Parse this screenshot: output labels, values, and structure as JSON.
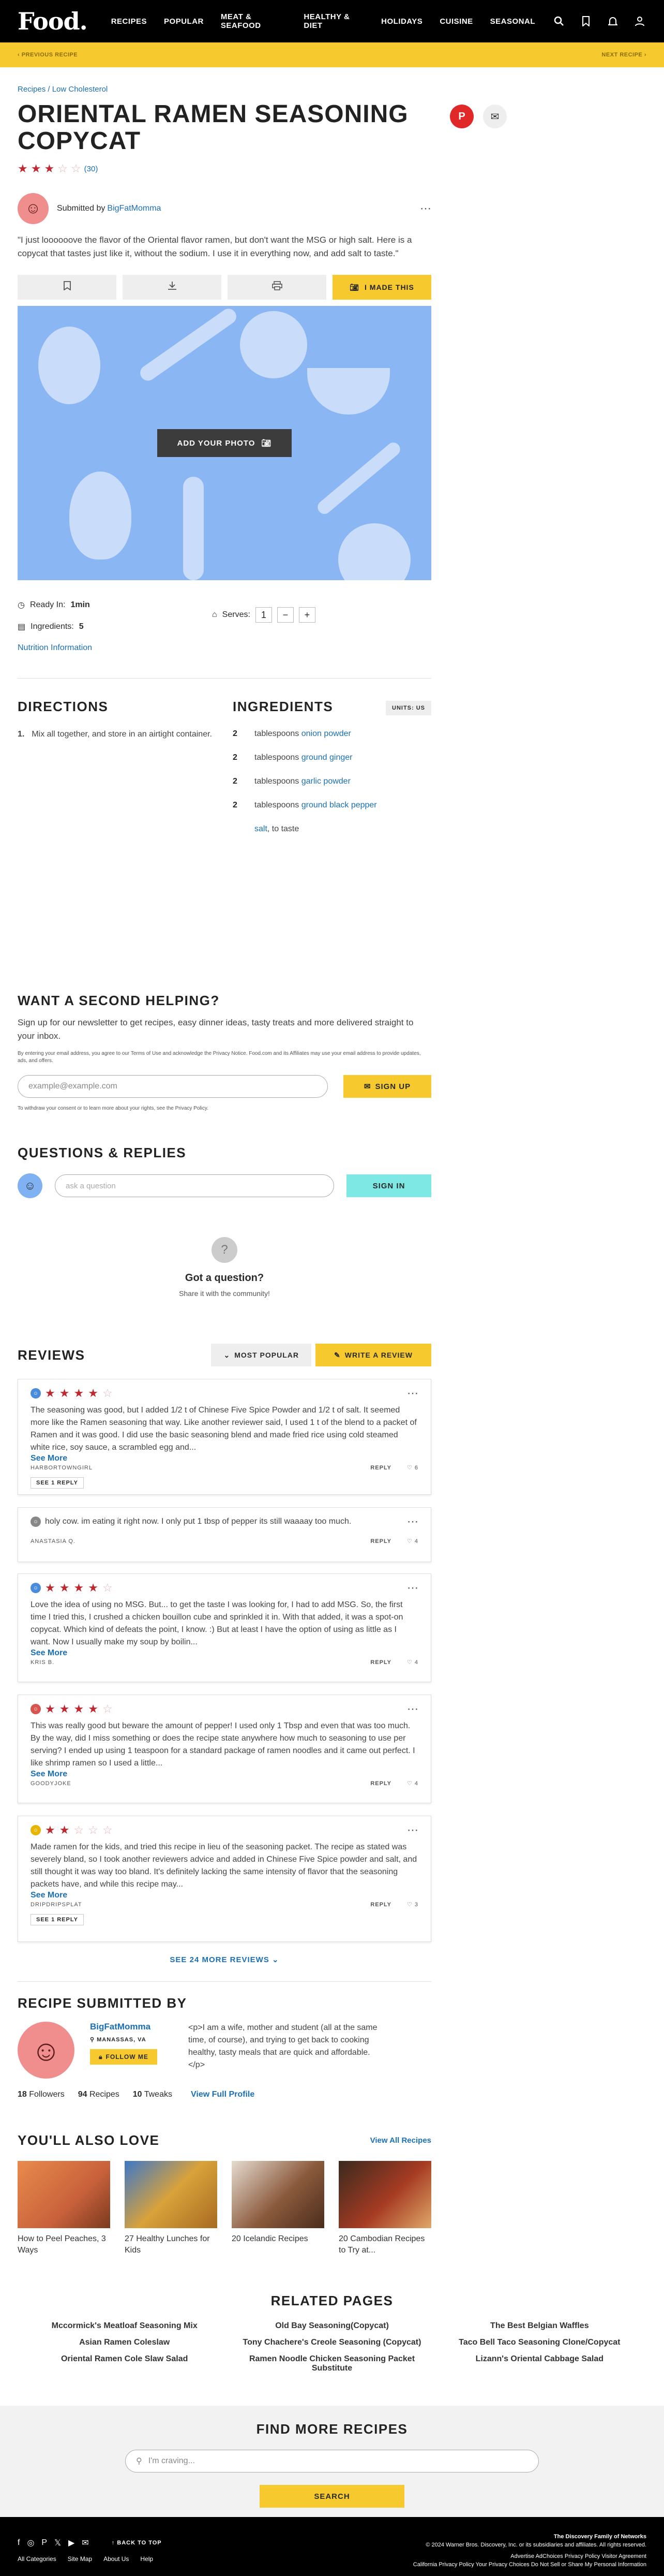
{
  "nav": {
    "logo": "Food.",
    "items": [
      "RECIPES",
      "POPULAR",
      "MEAT & SEAFOOD",
      "HEALTHY & DIET",
      "HOLIDAYS",
      "CUISINE",
      "SEASONAL"
    ],
    "icons": [
      "search-icon",
      "bookmark-icon",
      "bell-icon",
      "user-icon"
    ]
  },
  "promo": {
    "prev": "‹ PREVIOUS RECIPE",
    "next": "NEXT RECIPE ›"
  },
  "breadcrumb": "Recipes / Low Cholesterol",
  "recipe": {
    "title": "ORIENTAL RAMEN SEASONING COPYCAT",
    "rating": 3,
    "rating_count": "(30)",
    "submitted_prefix": "Submitted by",
    "author": "BigFatMomma",
    "quote": "\"I just loooooove the flavor of the Oriental flavor ramen, but don't want the MSG or high salt. Here is a copycat that tastes just like it, without the sodium. I use it in everything now, and add salt to taste.\"",
    "made_this": "I MADE THIS",
    "add_photo": "ADD YOUR PHOTO",
    "ready_label": "Ready In:",
    "ready_value": "1min",
    "ingredients_label": "Ingredients:",
    "ingredients_value": "5",
    "serves_label": "Serves:",
    "serves_value": "1",
    "nutrition": "Nutrition Information"
  },
  "directions": {
    "title": "DIRECTIONS",
    "steps": [
      "Mix all together, and store in an airtight container."
    ]
  },
  "ingredients": {
    "title": "INGREDIENTS",
    "units": "UNITS: US",
    "items": [
      {
        "qty": "2",
        "unit": "tablespoons",
        "name": "onion powder",
        "suffix": ""
      },
      {
        "qty": "2",
        "unit": "tablespoons",
        "name": "ground ginger",
        "suffix": ""
      },
      {
        "qty": "2",
        "unit": "tablespoons",
        "name": "garlic powder",
        "suffix": ""
      },
      {
        "qty": "2",
        "unit": "tablespoons",
        "name": "ground black pepper",
        "suffix": ""
      },
      {
        "qty": "",
        "unit": "",
        "name": "salt",
        "suffix": ", to taste"
      }
    ]
  },
  "newsletter": {
    "title": "WANT A SECOND HELPING?",
    "subtitle": "Sign up for our newsletter to get recipes, easy dinner ideas, tasty treats and more delivered straight to your inbox.",
    "legal": "By entering your email address, you agree to our Terms of Use and acknowledge the Privacy Notice. Food.com and its Affiliates may use your email address to provide updates, ads, and offers.",
    "placeholder": "example@example.com",
    "button": "SIGN UP",
    "withdraw": "To withdraw your consent or to learn more about your rights, see the Privacy Policy."
  },
  "qa": {
    "title": "QUESTIONS & REPLIES",
    "placeholder": "ask a question",
    "signin": "SIGN IN",
    "got_title": "Got a question?",
    "got_sub": "Share it with the community!"
  },
  "reviews": {
    "title": "REVIEWS",
    "sort": "MOST POPULAR",
    "write": "WRITE A REVIEW",
    "see_more": "See More",
    "reply": "REPLY",
    "items": [
      {
        "stars": 4,
        "avatar_color": "#4a8bdc",
        "text": "The seasoning was good, but I added 1/2 t of Chinese Five Spice Powder and 1/2 t of salt. It seemed more like the Ramen seasoning that way. Like another reviewer said, I used 1 t of the blend to a packet of Ramen and it was good. I did use the basic seasoning blend and made fried rice using cold steamed white rice, soy sauce, a scrambled egg and...",
        "user": "HARBORTOWNGIRL",
        "likes": "6",
        "replies": "SEE 1 REPLY",
        "more": true
      },
      {
        "stars": 0,
        "avatar_color": "#888888",
        "text": "holy cow. im eating it right now. I only put 1 tbsp of pepper its still waaaay too much.",
        "user": "ANASTASIA Q.",
        "likes": "4",
        "replies": "",
        "more": false
      },
      {
        "stars": 4,
        "avatar_color": "#4a8bdc",
        "text": "Love the idea of using no MSG. But... to get the taste I was looking for, I had to add MSG. So, the first time I tried this, I crushed a chicken bouillon cube and sprinkled it in. With that added, it was a spot-on copycat. Which kind of defeats the point, I know. :) But at least I have the option of using as little as I want. Now I usually make my soup by boilin...",
        "user": "KRIS B.",
        "likes": "4",
        "replies": "",
        "more": true
      },
      {
        "stars": 4,
        "avatar_color": "#d9534f",
        "text": "This was really good but beware the amount of pepper! I used only 1 Tbsp and even that was too much. By the way, did I miss something or does the recipe state anywhere how much to seasoning to use per serving? I ended up using 1 teaspoon for a standard package of ramen noodles and it came out perfect. I like shrimp ramen so I used a little...",
        "user": "GOODYJOKE",
        "likes": "4",
        "replies": "",
        "more": true
      },
      {
        "stars": 2,
        "avatar_color": "#e8b400",
        "text": "Made ramen for the kids, and tried this recipe in lieu of the seasoning packet. The recipe as stated was severely bland, so I took another reviewers advice and added in Chinese Five Spice powder and salt, and still thought it was way too bland. It's definitely lacking the same intensity of flavor that the seasoning packets have, and while this recipe may...",
        "user": "DRIPDRIPSPLAT",
        "likes": "3",
        "replies": "SEE 1 REPLY",
        "more": true
      }
    ],
    "see_more_reviews": "SEE 24 MORE REVIEWS"
  },
  "submitter": {
    "title": "RECIPE SUBMITTED BY",
    "name": "BigFatMomma",
    "location": "MANASSAS, VA",
    "follow": "FOLLOW ME",
    "bio": "<p>I am a wife, mother and student (all at the same time, of course), and trying to get back to cooking healthy, tasty meals that are quick and affordable.</p>",
    "followers_n": "18",
    "followers_label": "Followers",
    "recipes_n": "94",
    "recipes_label": "Recipes",
    "tweaks_n": "10",
    "tweaks_label": "Tweaks",
    "profile": "View Full Profile"
  },
  "love": {
    "title": "YOU'LL ALSO LOVE",
    "view_all": "View All Recipes",
    "cards": [
      {
        "title": "How to Peel Peaches, 3 Ways",
        "color": "#c9613c"
      },
      {
        "title": "27 Healthy Lunches for Kids",
        "color": "#c58a2c"
      },
      {
        "title": "20 Icelandic Recipes",
        "color": "#8b5a3c"
      },
      {
        "title": "20 Cambodian Recipes to Try at...",
        "color": "#a63b22"
      }
    ]
  },
  "related": {
    "title": "RELATED PAGES",
    "items": [
      "Mccormick's Meatloaf Seasoning Mix",
      "Old Bay Seasoning(Copycat)",
      "The Best Belgian Waffles",
      "Asian Ramen Coleslaw",
      "Tony Chachere's Creole Seasoning (Copycat)",
      "Taco Bell Taco Seasoning Clone/Copycat",
      "Oriental Ramen Cole Slaw Salad",
      "Ramen Noodle Chicken Seasoning Packet Substitute",
      "Lizann's Oriental Cabbage Salad"
    ]
  },
  "find": {
    "title": "FIND MORE RECIPES",
    "placeholder": "I'm craving...",
    "button": "SEARCH"
  },
  "footer": {
    "back_top": "BACK TO TOP",
    "links": [
      "All Categories",
      "Site Map",
      "About Us",
      "Help"
    ],
    "right1": "The Discovery Family of Networks",
    "right2": "© 2024 Warner Bros. Discovery, Inc. or its subsidiaries and affiliates. All rights reserved.",
    "right3": "Advertise   AdChoices   Privacy Policy   Visitor Agreement",
    "right4": "California Privacy Policy   Your Privacy Choices   Do Not Sell or Share My Personal Information"
  },
  "colors": {
    "accent": "#f6c92e",
    "link": "#1a6fb5",
    "star": "#c0282f",
    "hero_bg": "#8ab6f4"
  }
}
